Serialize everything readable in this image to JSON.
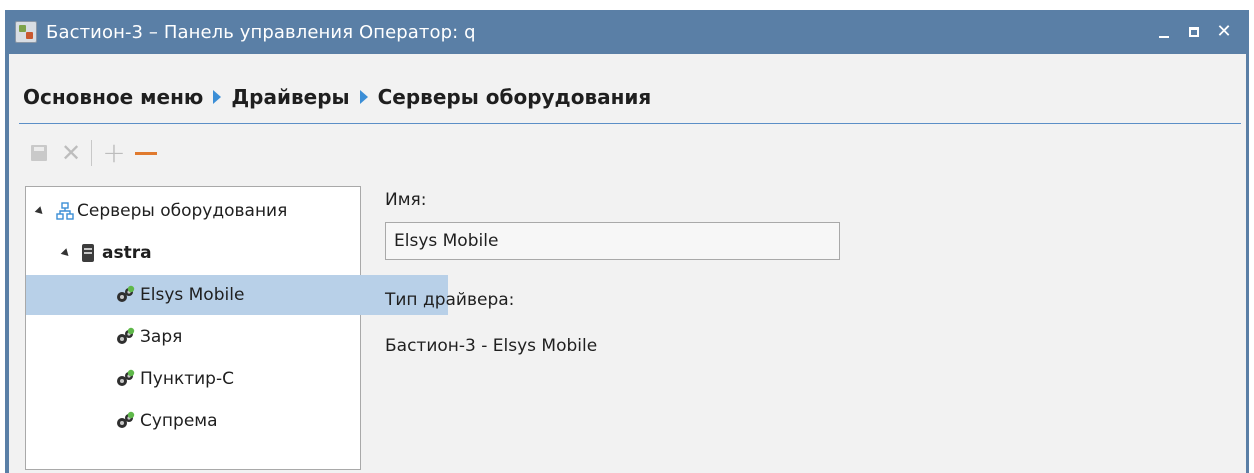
{
  "window": {
    "title": "Бастион-3 – Панель управления Оператор: q",
    "controls": {
      "close": "✕"
    }
  },
  "breadcrumb": [
    "Основное меню",
    "Драйверы",
    "Серверы оборудования"
  ],
  "toolbar": {
    "icons": [
      "save-icon",
      "delete-icon",
      "add-icon",
      "remove-icon"
    ]
  },
  "tree": {
    "root": "Серверы оборудования",
    "server": "astra",
    "drivers": [
      "Elsys Mobile",
      "Заря",
      "Пунктир-С",
      "Супрема"
    ],
    "selected": "Elsys Mobile"
  },
  "form": {
    "name_label": "Имя:",
    "name_value": "Elsys Mobile",
    "driver_type_label": "Тип драйвера:",
    "driver_type_value": "Бастион-3 - Elsys Mobile"
  },
  "colors": {
    "titlebar": "#5a7fa6",
    "accent": "#3b8ed6",
    "selection": "#b8d0e8",
    "remove": "#e07a2e"
  }
}
